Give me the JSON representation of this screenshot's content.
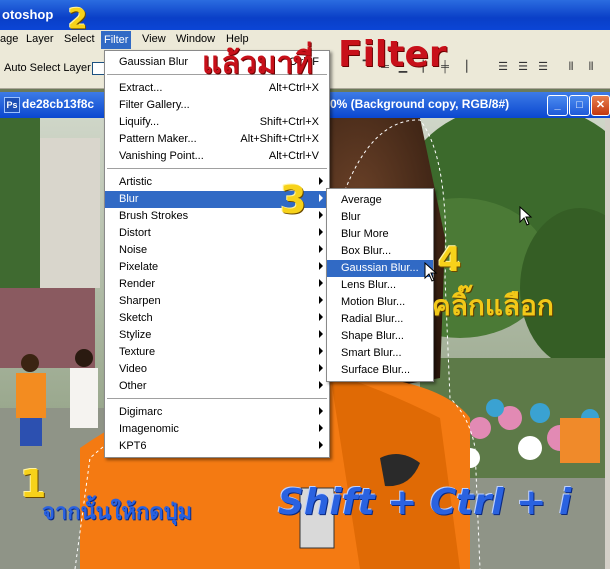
{
  "app": {
    "title": "otoshop"
  },
  "menubar": [
    {
      "label": "age"
    },
    {
      "label": "Layer"
    },
    {
      "label": "Select"
    },
    {
      "label": "Filter"
    },
    {
      "label": "View"
    },
    {
      "label": "Window"
    },
    {
      "label": "Help"
    }
  ],
  "options": {
    "auto_select": "Auto Select Layer"
  },
  "document": {
    "title_left": "de28cb13f8c",
    "title_right": "0% (Background copy, RGB/8#)"
  },
  "filter_menu": {
    "last_filter": {
      "label": "Gaussian Blur",
      "shortcut": "Ctrl+F"
    },
    "group1": [
      {
        "label": "Extract...",
        "shortcut": "Alt+Ctrl+X"
      },
      {
        "label": "Filter Gallery..."
      },
      {
        "label": "Liquify...",
        "shortcut": "Shift+Ctrl+X"
      },
      {
        "label": "Pattern Maker...",
        "shortcut": "Alt+Shift+Ctrl+X"
      },
      {
        "label": "Vanishing Point...",
        "shortcut": "Alt+Ctrl+V"
      }
    ],
    "group2": [
      {
        "label": "Artistic"
      },
      {
        "label": "Blur"
      },
      {
        "label": "Brush Strokes"
      },
      {
        "label": "Distort"
      },
      {
        "label": "Noise"
      },
      {
        "label": "Pixelate"
      },
      {
        "label": "Render"
      },
      {
        "label": "Sharpen"
      },
      {
        "label": "Sketch"
      },
      {
        "label": "Stylize"
      },
      {
        "label": "Texture"
      },
      {
        "label": "Video"
      },
      {
        "label": "Other"
      }
    ],
    "group3": [
      {
        "label": "Digimarc"
      },
      {
        "label": "Imagenomic"
      },
      {
        "label": "KPT6"
      }
    ]
  },
  "blur_menu": [
    {
      "label": "Average"
    },
    {
      "label": "Blur"
    },
    {
      "label": "Blur More"
    },
    {
      "label": "Box Blur..."
    },
    {
      "label": "Gaussian Blur..."
    },
    {
      "label": "Lens Blur..."
    },
    {
      "label": "Motion Blur..."
    },
    {
      "label": "Radial Blur..."
    },
    {
      "label": "Shape Blur..."
    },
    {
      "label": "Smart Blur..."
    },
    {
      "label": "Surface Blur..."
    }
  ],
  "annotations": {
    "step1": "1",
    "step2": "2",
    "step3": "3",
    "step4": "4",
    "top_text_thai": "แล้วมาที่",
    "top_text_filter": "Filter",
    "click_select": "คลิ๊กแลือก",
    "bottom_thai": "จากนั้นให้กดปุ่ม",
    "bottom_keys": "Shift + Ctrl + i"
  },
  "colors": {
    "selection": "#316ac5",
    "annotation_red": "#c8101a",
    "annotation_blue": "#2a62e0",
    "annotation_yellow": "#f7d21a"
  }
}
